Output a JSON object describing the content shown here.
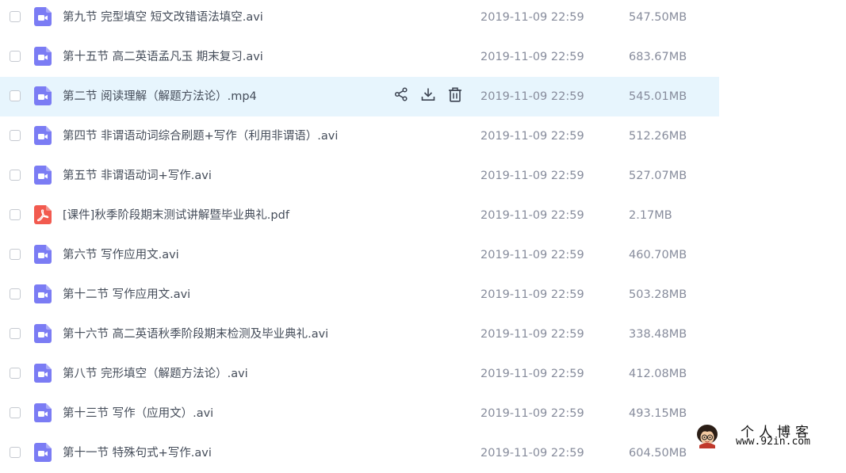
{
  "colors": {
    "video_icon": "#7b7cf4",
    "pdf_icon": "#f25a4f",
    "hover_row": "#e7f5fd",
    "name_text": "#454d5a",
    "meta_text": "#878c9c",
    "action_icon": "#3b4250"
  },
  "files": [
    {
      "name": "第九节 完型填空 短文改错语法填空.avi",
      "date": "2019-11-09 22:59",
      "size": "547.50MB",
      "type": "video-file-icon",
      "hovered": false
    },
    {
      "name": "第十五节 高二英语孟凡玉 期末复习.avi",
      "date": "2019-11-09 22:59",
      "size": "683.67MB",
      "type": "video-file-icon",
      "hovered": false
    },
    {
      "name": "第二节 阅读理解（解题方法论）.mp4",
      "date": "2019-11-09 22:59",
      "size": "545.01MB",
      "type": "video-file-icon",
      "hovered": true
    },
    {
      "name": "第四节 非谓语动词综合刷题+写作（利用非谓语）.avi",
      "date": "2019-11-09 22:59",
      "size": "512.26MB",
      "type": "video-file-icon",
      "hovered": false
    },
    {
      "name": "第五节 非谓语动词+写作.avi",
      "date": "2019-11-09 22:59",
      "size": "527.07MB",
      "type": "video-file-icon",
      "hovered": false
    },
    {
      "name": "[课件]秋季阶段期末测试讲解暨毕业典礼.pdf",
      "date": "2019-11-09 22:59",
      "size": "2.17MB",
      "type": "pdf-file-icon",
      "hovered": false
    },
    {
      "name": "第六节 写作应用文.avi",
      "date": "2019-11-09 22:59",
      "size": "460.70MB",
      "type": "video-file-icon",
      "hovered": false
    },
    {
      "name": "第十二节 写作应用文.avi",
      "date": "2019-11-09 22:59",
      "size": "503.28MB",
      "type": "video-file-icon",
      "hovered": false
    },
    {
      "name": "第十六节 高二英语秋季阶段期末检测及毕业典礼.avi",
      "date": "2019-11-09 22:59",
      "size": "338.48MB",
      "type": "video-file-icon",
      "hovered": false
    },
    {
      "name": "第八节 完形填空（解题方法论）.avi",
      "date": "2019-11-09 22:59",
      "size": "412.08MB",
      "type": "video-file-icon",
      "hovered": false
    },
    {
      "name": "第十三节 写作（应用文）.avi",
      "date": "2019-11-09 22:59",
      "size": "493.15MB",
      "type": "video-file-icon",
      "hovered": false
    },
    {
      "name": "第十一节 特殊句式+写作.avi",
      "date": "2019-11-09 22:59",
      "size": "604.50MB",
      "type": "video-file-icon",
      "hovered": false
    }
  ],
  "row_actions": [
    {
      "name": "share-button",
      "icon": "share-icon"
    },
    {
      "name": "download-button",
      "icon": "download-icon"
    },
    {
      "name": "delete-button",
      "icon": "trash-icon"
    }
  ],
  "watermark": {
    "title": "个人博客",
    "url": "www.92in.com"
  }
}
